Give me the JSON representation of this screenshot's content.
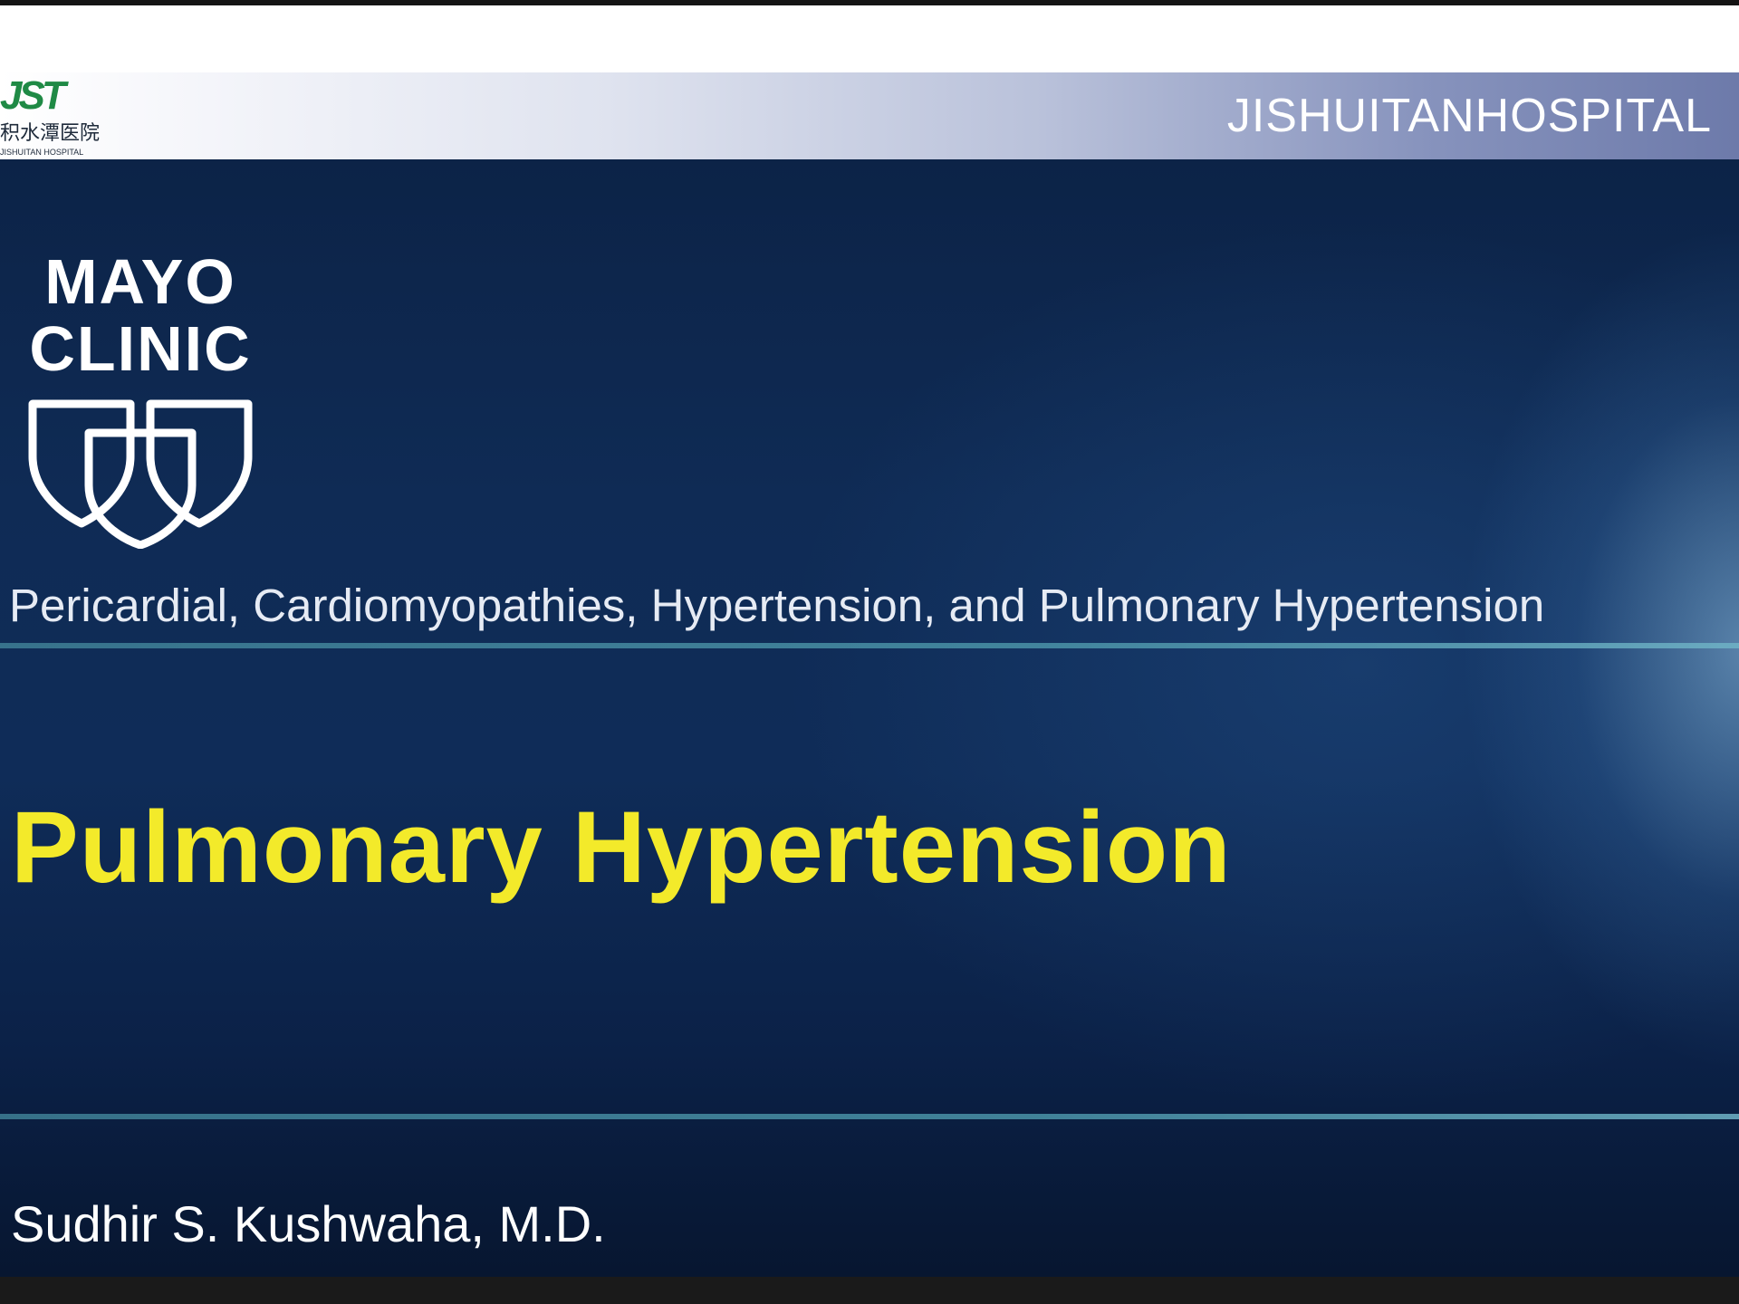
{
  "header": {
    "logo": {
      "mark": "JST",
      "chinese_text": "积水潭医院",
      "english_text": "JISHUITAN HOSPITAL"
    },
    "hospital_name": "JISHUITANHOSPITAL",
    "colors": {
      "logo_green": "#1f8a45",
      "bar_end": "#6d7aaa"
    }
  },
  "slide": {
    "logo": {
      "line1": "MAYO",
      "line2": "CLINIC",
      "icon": "mayo-three-shields-icon"
    },
    "subtitle": "Pericardial, Cardiomyopathies, Hypertension, and Pulmonary Hypertension",
    "title": "Pulmonary Hypertension",
    "author": "Sudhir S. Kushwaha, M.D.",
    "colors": {
      "background": "#0f2b55",
      "title": "#f3ea2a",
      "divider": "#4a93a8"
    }
  }
}
